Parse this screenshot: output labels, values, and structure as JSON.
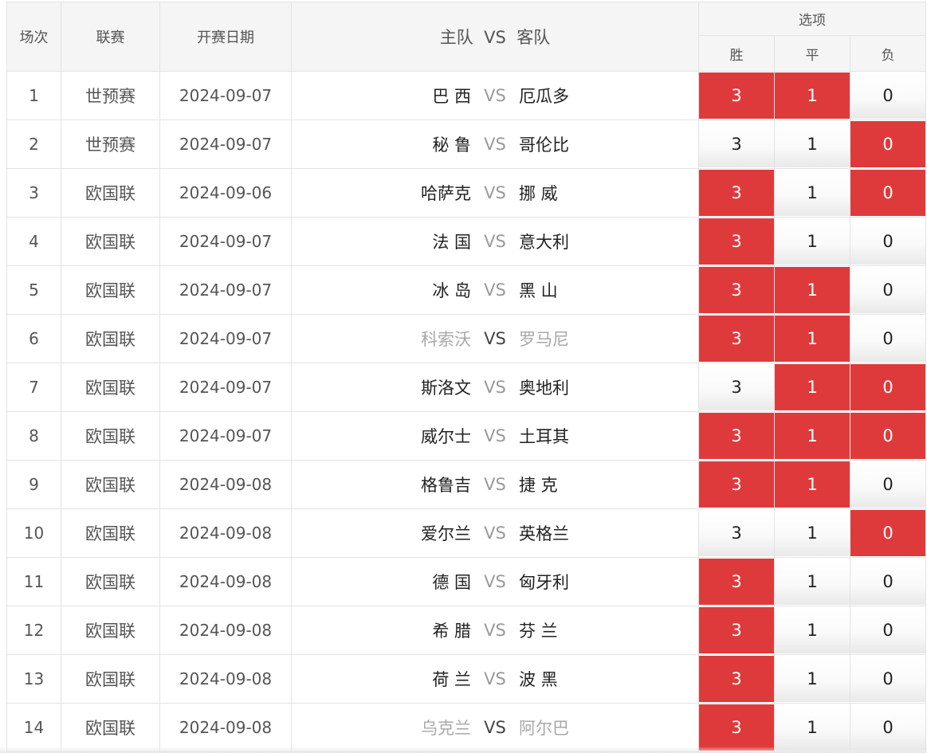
{
  "header": {
    "index": "场次",
    "league": "联赛",
    "date": "开赛日期",
    "home": "主队",
    "vs": "VS",
    "away": "客队",
    "options": "选项",
    "win": "胜",
    "draw": "平",
    "lose": "负"
  },
  "colors": {
    "selected": "#df3a3b",
    "border": "#e3e3e3",
    "header_bg": "#f5f5f5"
  },
  "rows": [
    {
      "index": "1",
      "league": "世预赛",
      "date": "2024-09-07",
      "home": "巴 西",
      "away": "厄瓜多",
      "win": "3",
      "draw": "1",
      "lose": "0",
      "sel": [
        true,
        true,
        false
      ],
      "muted": false
    },
    {
      "index": "2",
      "league": "世预赛",
      "date": "2024-09-07",
      "home": "秘 鲁",
      "away": "哥伦比",
      "win": "3",
      "draw": "1",
      "lose": "0",
      "sel": [
        false,
        false,
        true
      ],
      "muted": false
    },
    {
      "index": "3",
      "league": "欧国联",
      "date": "2024-09-06",
      "home": "哈萨克",
      "away": "挪 威",
      "win": "3",
      "draw": "1",
      "lose": "0",
      "sel": [
        true,
        false,
        true
      ],
      "muted": false
    },
    {
      "index": "4",
      "league": "欧国联",
      "date": "2024-09-07",
      "home": "法 国",
      "away": "意大利",
      "win": "3",
      "draw": "1",
      "lose": "0",
      "sel": [
        true,
        false,
        false
      ],
      "muted": false
    },
    {
      "index": "5",
      "league": "欧国联",
      "date": "2024-09-07",
      "home": "冰 岛",
      "away": "黑 山",
      "win": "3",
      "draw": "1",
      "lose": "0",
      "sel": [
        true,
        true,
        false
      ],
      "muted": false
    },
    {
      "index": "6",
      "league": "欧国联",
      "date": "2024-09-07",
      "home": "科索沃",
      "away": "罗马尼",
      "win": "3",
      "draw": "1",
      "lose": "0",
      "sel": [
        true,
        true,
        false
      ],
      "muted": true
    },
    {
      "index": "7",
      "league": "欧国联",
      "date": "2024-09-07",
      "home": "斯洛文",
      "away": "奥地利",
      "win": "3",
      "draw": "1",
      "lose": "0",
      "sel": [
        false,
        true,
        true
      ],
      "muted": false
    },
    {
      "index": "8",
      "league": "欧国联",
      "date": "2024-09-07",
      "home": "威尔士",
      "away": "土耳其",
      "win": "3",
      "draw": "1",
      "lose": "0",
      "sel": [
        true,
        true,
        true
      ],
      "muted": false
    },
    {
      "index": "9",
      "league": "欧国联",
      "date": "2024-09-08",
      "home": "格鲁吉",
      "away": "捷 克",
      "win": "3",
      "draw": "1",
      "lose": "0",
      "sel": [
        true,
        true,
        false
      ],
      "muted": false
    },
    {
      "index": "10",
      "league": "欧国联",
      "date": "2024-09-08",
      "home": "爱尔兰",
      "away": "英格兰",
      "win": "3",
      "draw": "1",
      "lose": "0",
      "sel": [
        false,
        false,
        true
      ],
      "muted": false
    },
    {
      "index": "11",
      "league": "欧国联",
      "date": "2024-09-08",
      "home": "德 国",
      "away": "匈牙利",
      "win": "3",
      "draw": "1",
      "lose": "0",
      "sel": [
        true,
        false,
        false
      ],
      "muted": false
    },
    {
      "index": "12",
      "league": "欧国联",
      "date": "2024-09-08",
      "home": "希 腊",
      "away": "芬 兰",
      "win": "3",
      "draw": "1",
      "lose": "0",
      "sel": [
        true,
        false,
        false
      ],
      "muted": false
    },
    {
      "index": "13",
      "league": "欧国联",
      "date": "2024-09-08",
      "home": "荷 兰",
      "away": "波 黑",
      "win": "3",
      "draw": "1",
      "lose": "0",
      "sel": [
        true,
        false,
        false
      ],
      "muted": false
    },
    {
      "index": "14",
      "league": "欧国联",
      "date": "2024-09-08",
      "home": "乌克兰",
      "away": "阿尔巴",
      "win": "3",
      "draw": "1",
      "lose": "0",
      "sel": [
        true,
        false,
        false
      ],
      "muted": true
    }
  ]
}
